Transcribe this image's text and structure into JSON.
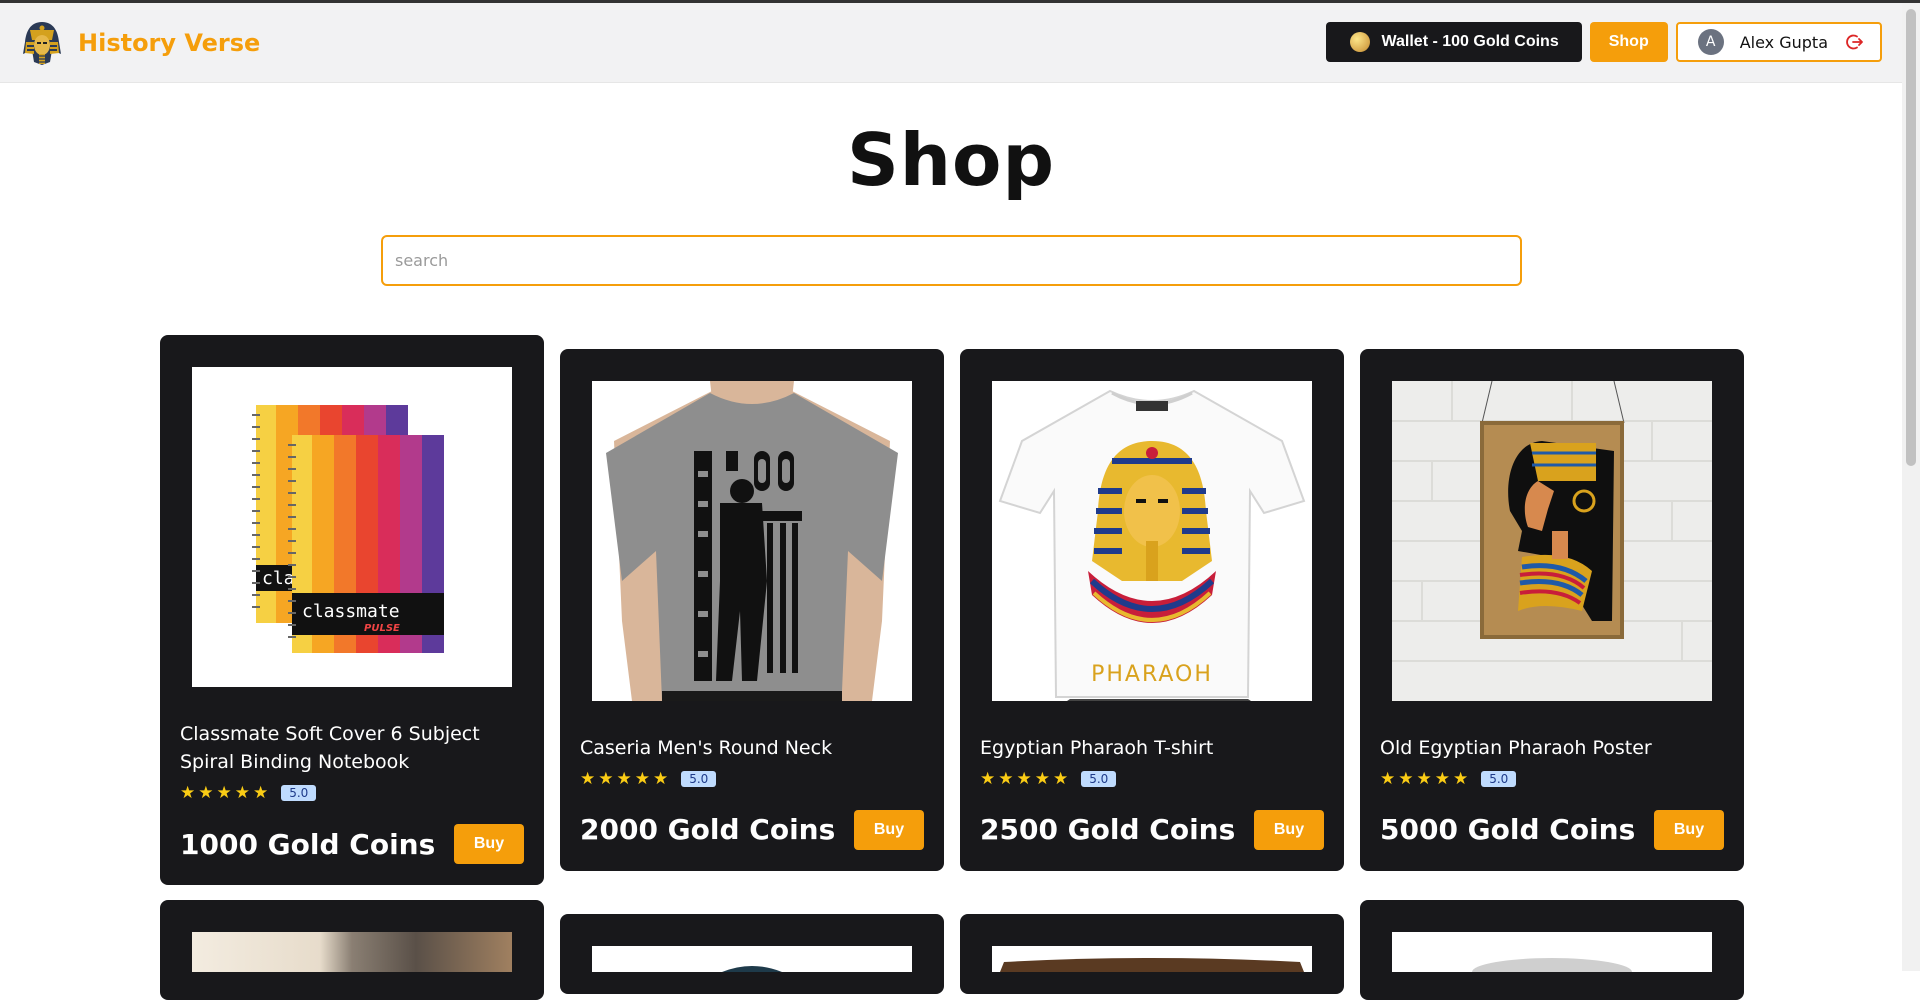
{
  "header": {
    "brand": "History Verse",
    "wallet_label": "Wallet - 100 Gold Coins",
    "shop_label": "Shop",
    "user_initial": "A",
    "user_name": "Alex Gupta"
  },
  "page": {
    "title": "Shop",
    "search_placeholder": "search"
  },
  "products": [
    {
      "name": "Classmate Soft Cover 6 Subject Spiral Binding Notebook",
      "rating": "5.0",
      "stars": "★★★★★",
      "price": "1000 Gold Coins",
      "buy": "Buy"
    },
    {
      "name": "Caseria Men's Round Neck",
      "rating": "5.0",
      "stars": "★★★★★",
      "price": "2000 Gold Coins",
      "buy": "Buy"
    },
    {
      "name": "Egyptian Pharaoh T-shirt",
      "rating": "5.0",
      "stars": "★★★★★",
      "price": "2500 Gold Coins",
      "buy": "Buy"
    },
    {
      "name": "Old Egyptian Pharaoh Poster",
      "rating": "5.0",
      "stars": "★★★★★",
      "price": "5000 Gold Coins",
      "buy": "Buy"
    }
  ],
  "product_images": {
    "notebook_lettering": "classmate",
    "notebook_sub": "PULSE",
    "notebook_back": "cla",
    "tshirt_lettering": "PHARAOH"
  },
  "colors": {
    "accent": "#f59e0b",
    "card_bg": "#18181b",
    "star": "#facc15"
  }
}
